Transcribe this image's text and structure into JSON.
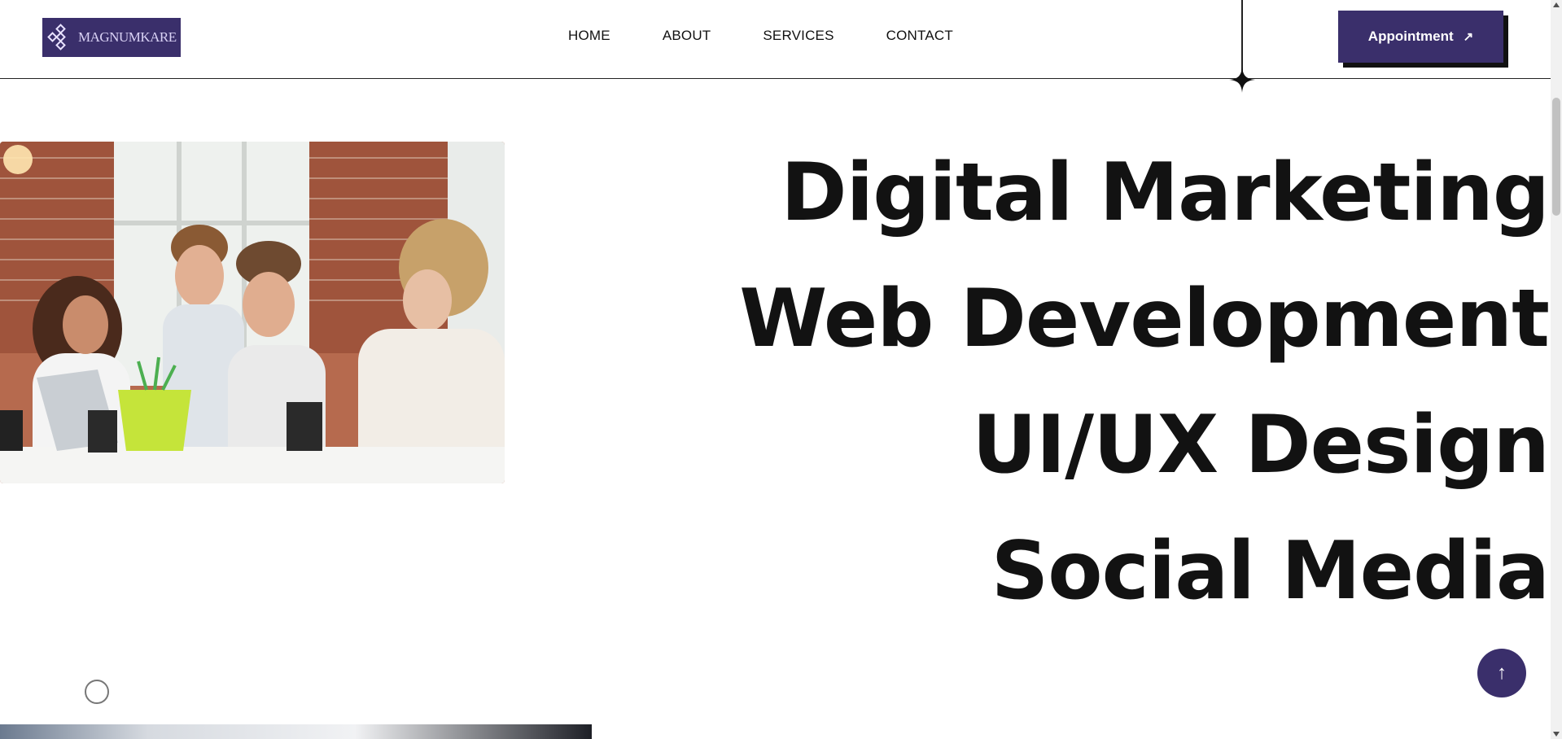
{
  "header": {
    "logo_text": "MAGNUMKARE",
    "nav": [
      {
        "label": "HOME"
      },
      {
        "label": "ABOUT"
      },
      {
        "label": "SERVICES"
      },
      {
        "label": "CONTACT"
      }
    ],
    "appointment_label": "Appointment",
    "appointment_icon": "arrow-up-right-icon"
  },
  "hero": {
    "image": "team-meeting-photo",
    "headlines": [
      "Digital Marketing",
      "Web Development",
      "UI/UX Design",
      "Social Media"
    ]
  },
  "back_to_top_icon": "arrow-up-icon",
  "colors": {
    "brand": "#3a2f6b",
    "text": "#121212",
    "background": "#ffffff"
  }
}
